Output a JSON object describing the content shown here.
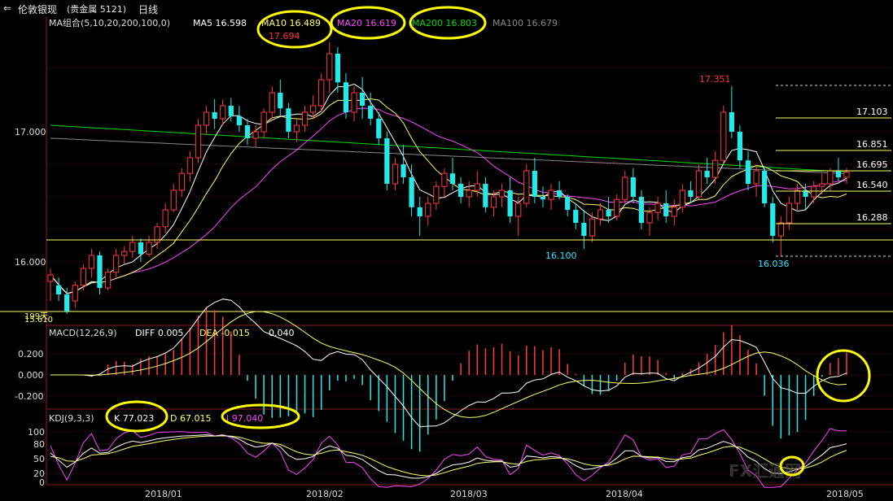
{
  "header": {
    "title": "伦敦银现",
    "subtitle": "(贵金属  5121)",
    "period": "日线"
  },
  "main_panel": {
    "ma_group_label": "MA组合(5,10,20,200,100,0)",
    "ma_values": [
      {
        "label": "MA5 16.598",
        "color": "#ffffff"
      },
      {
        "label": "MA10 16.489",
        "color": "#ffff66"
      },
      {
        "label": "MA20 16.619",
        "color": "#ff44ff"
      },
      {
        "label": "MA200 16.803",
        "color": "#00dd00"
      },
      {
        "label": "MA100 16.679",
        "color": "#888888"
      }
    ],
    "y_ticks": [
      "17.000",
      "16.000"
    ],
    "bottom_label_a": "15.610",
    "bottom_label_b": "199天",
    "annotations": [
      {
        "text": "17.694",
        "color": "#ff3333"
      },
      {
        "text": "17.351",
        "color": "#ff3333"
      },
      {
        "text": "16.100",
        "color": "#33e0ff"
      },
      {
        "text": "16.036",
        "color": "#33e0ff"
      }
    ],
    "right_levels": [
      "17.103",
      "16.851",
      "16.695",
      "16.540",
      "16.288"
    ]
  },
  "macd_panel": {
    "label": "MACD(12,26,9)",
    "diff": "DIFF 0.005",
    "dea": "DEA -0.015",
    "macd": "0.040",
    "y_ticks": [
      "0.200",
      "0.000",
      "-0.200"
    ]
  },
  "kdj_panel": {
    "label": "KDJ(9,3,3)",
    "k": "K 77.023",
    "d": "D 67.015",
    "j": "J 97.040",
    "y_ticks": [
      "100",
      "80",
      "50",
      "20",
      "0"
    ]
  },
  "x_axis": [
    "2018/01",
    "2018/02",
    "2018/03",
    "2018/04",
    "2018/05"
  ],
  "watermark": "FX汇通网",
  "colors": {
    "up": "#ff3b3b",
    "down": "#25e8e8",
    "level": "#ffff66",
    "ma200": "#00dd00",
    "highlight_circle": "#ffff00"
  },
  "chart_data": {
    "type": "candlestick",
    "series_note": "daily OHLC, Dec 2017 - May 2018 (values estimated from chart)",
    "ylim": [
      15.55,
      17.9
    ],
    "ohlc": [
      [
        15.85,
        15.95,
        15.7,
        15.9
      ],
      [
        15.82,
        15.88,
        15.7,
        15.75
      ],
      [
        15.75,
        15.8,
        15.6,
        15.62
      ],
      [
        15.7,
        15.85,
        15.65,
        15.82
      ],
      [
        15.82,
        15.98,
        15.78,
        15.95
      ],
      [
        15.95,
        16.1,
        15.88,
        16.05
      ],
      [
        16.05,
        16.08,
        15.75,
        15.8
      ],
      [
        15.8,
        15.95,
        15.78,
        15.92
      ],
      [
        15.92,
        16.1,
        15.88,
        16.05
      ],
      [
        16.05,
        16.12,
        15.98,
        16.08
      ],
      [
        16.08,
        16.2,
        16.03,
        16.15
      ],
      [
        16.15,
        16.18,
        16.0,
        16.06
      ],
      [
        16.06,
        16.2,
        16.04,
        16.15
      ],
      [
        16.15,
        16.3,
        16.1,
        16.27
      ],
      [
        16.27,
        16.45,
        16.22,
        16.4
      ],
      [
        16.4,
        16.6,
        16.38,
        16.55
      ],
      [
        16.55,
        16.72,
        16.5,
        16.68
      ],
      [
        16.68,
        16.85,
        16.62,
        16.8
      ],
      [
        16.8,
        17.1,
        16.76,
        17.05
      ],
      [
        17.05,
        17.2,
        16.98,
        17.15
      ],
      [
        17.15,
        17.25,
        17.02,
        17.1
      ],
      [
        17.1,
        17.25,
        17.05,
        17.2
      ],
      [
        17.2,
        17.26,
        17.08,
        17.12
      ],
      [
        17.12,
        17.2,
        17.0,
        17.05
      ],
      [
        17.05,
        17.1,
        16.9,
        16.95
      ],
      [
        16.95,
        17.05,
        16.88,
        17.0
      ],
      [
        17.0,
        17.18,
        16.95,
        17.15
      ],
      [
        17.15,
        17.35,
        17.1,
        17.3
      ],
      [
        17.3,
        17.4,
        17.12,
        17.18
      ],
      [
        17.18,
        17.22,
        16.95,
        17.0
      ],
      [
        17.0,
        17.1,
        16.92,
        17.05
      ],
      [
        17.05,
        17.2,
        17.0,
        17.15
      ],
      [
        17.15,
        17.28,
        17.1,
        17.2
      ],
      [
        17.2,
        17.45,
        17.15,
        17.4
      ],
      [
        17.4,
        17.69,
        17.3,
        17.6
      ],
      [
        17.6,
        17.65,
        17.3,
        17.38
      ],
      [
        17.38,
        17.45,
        17.1,
        17.15
      ],
      [
        17.15,
        17.35,
        17.08,
        17.3
      ],
      [
        17.3,
        17.42,
        17.1,
        17.2
      ],
      [
        17.2,
        17.3,
        17.05,
        17.1
      ],
      [
        17.1,
        17.15,
        16.9,
        16.95
      ],
      [
        16.95,
        17.0,
        16.55,
        16.6
      ],
      [
        16.6,
        16.8,
        16.55,
        16.75
      ],
      [
        16.75,
        16.9,
        16.6,
        16.65
      ],
      [
        16.65,
        16.75,
        16.35,
        16.42
      ],
      [
        16.42,
        16.5,
        16.2,
        16.35
      ],
      [
        16.35,
        16.5,
        16.28,
        16.45
      ],
      [
        16.45,
        16.62,
        16.4,
        16.58
      ],
      [
        16.58,
        16.72,
        16.5,
        16.68
      ],
      [
        16.68,
        16.8,
        16.55,
        16.6
      ],
      [
        16.6,
        16.65,
        16.45,
        16.5
      ],
      [
        16.5,
        16.62,
        16.42,
        16.55
      ],
      [
        16.55,
        16.7,
        16.5,
        16.6
      ],
      [
        16.6,
        16.65,
        16.38,
        16.42
      ],
      [
        16.42,
        16.55,
        16.35,
        16.5
      ],
      [
        16.5,
        16.6,
        16.42,
        16.55
      ],
      [
        16.55,
        16.65,
        16.3,
        16.35
      ],
      [
        16.35,
        16.5,
        16.2,
        16.45
      ],
      [
        16.45,
        16.75,
        16.42,
        16.7
      ],
      [
        16.7,
        16.8,
        16.45,
        16.5
      ],
      [
        16.5,
        16.58,
        16.42,
        16.48
      ],
      [
        16.48,
        16.6,
        16.4,
        16.55
      ],
      [
        16.55,
        16.62,
        16.48,
        16.5
      ],
      [
        16.5,
        16.52,
        16.35,
        16.4
      ],
      [
        16.4,
        16.45,
        16.25,
        16.3
      ],
      [
        16.3,
        16.4,
        16.1,
        16.2
      ],
      [
        16.2,
        16.38,
        16.15,
        16.33
      ],
      [
        16.33,
        16.45,
        16.28,
        16.4
      ],
      [
        16.4,
        16.5,
        16.3,
        16.35
      ],
      [
        16.35,
        16.52,
        16.32,
        16.48
      ],
      [
        16.48,
        16.7,
        16.45,
        16.65
      ],
      [
        16.65,
        16.72,
        16.45,
        16.5
      ],
      [
        16.5,
        16.55,
        16.25,
        16.3
      ],
      [
        16.3,
        16.42,
        16.2,
        16.38
      ],
      [
        16.38,
        16.5,
        16.32,
        16.45
      ],
      [
        16.45,
        16.55,
        16.3,
        16.35
      ],
      [
        16.35,
        16.48,
        16.28,
        16.42
      ],
      [
        16.42,
        16.6,
        16.38,
        16.55
      ],
      [
        16.55,
        16.62,
        16.45,
        16.5
      ],
      [
        16.5,
        16.75,
        16.48,
        16.7
      ],
      [
        16.7,
        16.8,
        16.6,
        16.65
      ],
      [
        16.65,
        16.85,
        16.6,
        16.78
      ],
      [
        16.78,
        17.2,
        16.75,
        17.15
      ],
      [
        17.15,
        17.35,
        16.95,
        17.0
      ],
      [
        17.0,
        17.05,
        16.72,
        16.78
      ],
      [
        16.78,
        16.85,
        16.55,
        16.6
      ],
      [
        16.6,
        16.75,
        16.5,
        16.7
      ],
      [
        16.7,
        16.72,
        16.42,
        16.45
      ],
      [
        16.45,
        16.5,
        16.15,
        16.2
      ],
      [
        16.2,
        16.35,
        16.04,
        16.3
      ],
      [
        16.3,
        16.5,
        16.25,
        16.45
      ],
      [
        16.45,
        16.6,
        16.4,
        16.55
      ],
      [
        16.55,
        16.6,
        16.4,
        16.5
      ],
      [
        16.5,
        16.62,
        16.45,
        16.58
      ],
      [
        16.58,
        16.68,
        16.52,
        16.6
      ],
      [
        16.6,
        16.72,
        16.55,
        16.7
      ],
      [
        16.7,
        16.8,
        16.62,
        16.65
      ],
      [
        16.65,
        16.72,
        16.6,
        16.69
      ]
    ]
  }
}
